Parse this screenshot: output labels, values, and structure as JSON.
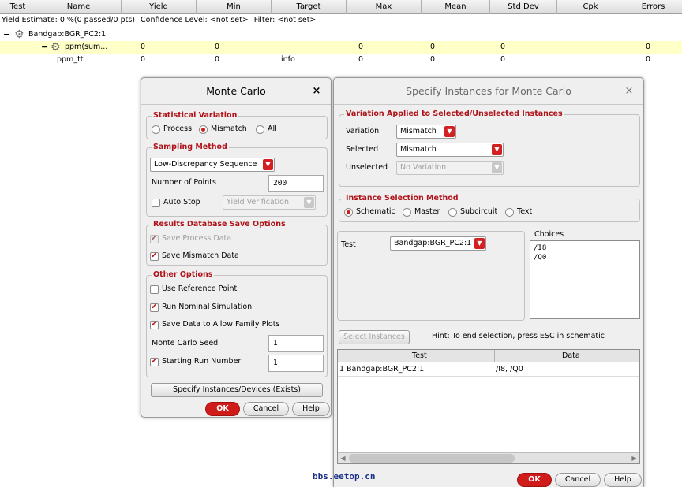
{
  "table": {
    "columns": [
      "Test",
      "Name",
      "Yield",
      "Min",
      "Target",
      "Max",
      "Mean",
      "Std Dev",
      "Cpk",
      "Errors"
    ],
    "yield_line": {
      "estimate": "Yield Estimate: 0 %(0 passed/0 pts)",
      "confidence": "Confidence Level: <not set>",
      "filter": "Filter: <not set>"
    },
    "rows": [
      {
        "test": "Bandgap:BGR_PC2:1"
      },
      {
        "name": "ppm(sum...",
        "yield": "0",
        "min": "0",
        "target": "",
        "max": "0",
        "mean": "0",
        "stddev": "0",
        "cpk": "",
        "errors": "0"
      },
      {
        "name": "ppm_tt",
        "yield": "0",
        "min": "0",
        "target": "info",
        "max": "0",
        "mean": "0",
        "stddev": "0",
        "cpk": "",
        "errors": "0"
      }
    ]
  },
  "monte_carlo": {
    "title": "Monte Carlo",
    "close": "×",
    "statistical_variation": {
      "title": "Statistical Variation",
      "options": [
        "Process",
        "Mismatch",
        "All"
      ],
      "selected": "Mismatch"
    },
    "sampling": {
      "title": "Sampling Method",
      "method": "Low-Discrepancy Sequence",
      "num_points_label": "Number of Points",
      "num_points": "200",
      "auto_stop_label": "Auto Stop",
      "auto_stop_checked": false,
      "auto_stop_mode": "Yield Verification"
    },
    "results_db": {
      "title": "Results Database Save Options",
      "save_process": "Save Process Data",
      "save_process_checked": true,
      "save_mismatch": "Save Mismatch Data",
      "save_mismatch_checked": true
    },
    "other": {
      "title": "Other Options",
      "use_ref": "Use Reference Point",
      "use_ref_checked": false,
      "run_nominal": "Run Nominal Simulation",
      "run_nominal_checked": true,
      "save_family": "Save Data to Allow Family Plots",
      "save_family_checked": true,
      "seed_label": "Monte Carlo Seed",
      "seed": "1",
      "start_run_label": "Starting Run Number",
      "start_run_checked": true,
      "start_run": "1"
    },
    "specify_button": "Specify Instances/Devices (Exists)",
    "ok": "OK",
    "cancel": "Cancel",
    "help": "Help"
  },
  "specify": {
    "title": "Specify Instances for Monte Carlo",
    "close": "×",
    "variation_group": {
      "title": "Variation Applied to Selected/Unselected Instances",
      "variation_label": "Variation",
      "variation": "Mismatch",
      "selected_label": "Selected",
      "selected": "Mismatch",
      "unselected_label": "Unselected",
      "unselected": "No Variation"
    },
    "instance_method": {
      "title": "Instance Selection Method",
      "options": [
        "Schematic",
        "Master",
        "Subcircuit",
        "Text"
      ],
      "selected": "Schematic"
    },
    "test_label": "Test",
    "test": "Bandgap:BGR_PC2:1",
    "choices_label": "Choices",
    "choices": [
      "/I8",
      "/Q0"
    ],
    "select_instances": "Select Instances",
    "hint": "Hint: To end selection, press ESC in schematic",
    "table": {
      "columns": [
        "Test",
        "Data"
      ],
      "rows": [
        {
          "num": "1",
          "test": "Bandgap:BGR_PC2:1",
          "data": "/I8, /Q0"
        }
      ]
    },
    "ok": "OK",
    "cancel": "Cancel",
    "help": "Help"
  },
  "watermark": "bbs.eetop.cn",
  "colors": {
    "accent": "#d01b1b",
    "group_title": "#b0141a",
    "highlight_row": "#ffffc8"
  }
}
